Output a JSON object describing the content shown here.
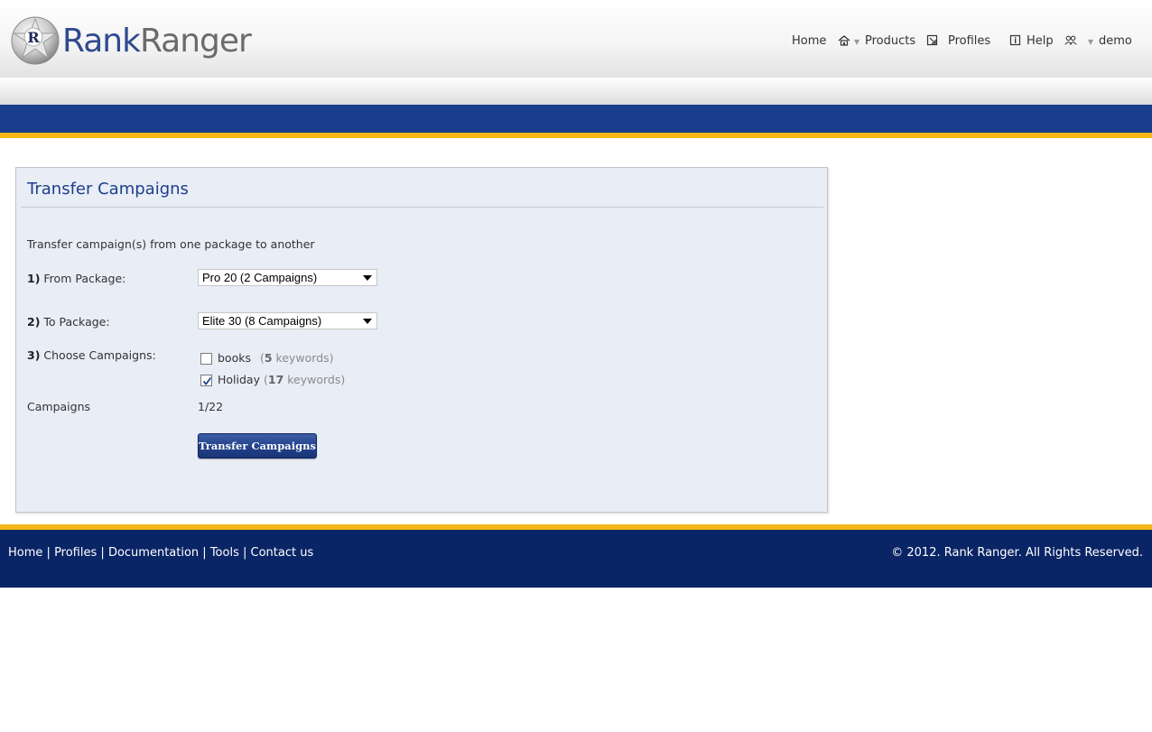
{
  "brand": {
    "name_part1": "Rank",
    "name_part2": "Ranger",
    "emblem_letter": "R"
  },
  "nav": {
    "home": "Home",
    "products": "Products",
    "profiles": "Profiles",
    "help": "Help",
    "user": "demo"
  },
  "panel": {
    "title": "Transfer Campaigns",
    "intro": "Transfer campaign(s) from one package to another",
    "from_num": "1)",
    "from_label": "From Package:",
    "from_value": "Pro 20 (2 Campaigns)",
    "to_num": "2)",
    "to_label": "To Package:",
    "to_value": "Elite 30 (8 Campaigns)",
    "choose_num": "3)",
    "choose_label": "Choose Campaigns:",
    "campaigns": [
      {
        "name": "books",
        "open": "(",
        "count": "5",
        "unit": " keywords)",
        "checked": false
      },
      {
        "name": "Holiday",
        "open": "(",
        "count": "17",
        "unit": " keywords)",
        "checked": true
      }
    ],
    "count_label": "Campaigns",
    "count_value": "1/22",
    "button": "Transfer Campaigns"
  },
  "footer": {
    "links": [
      "Home",
      "Profiles",
      "Documentation",
      "Tools",
      "Contact us"
    ],
    "separator": "|",
    "copyright": "© 2012. Rank Ranger. All Rights Reserved."
  },
  "colors": {
    "brand_blue": "#183e8c",
    "accent_gold": "#f4b716",
    "footer_navy": "#0a2566",
    "panel_bg": "#e9edf6"
  }
}
